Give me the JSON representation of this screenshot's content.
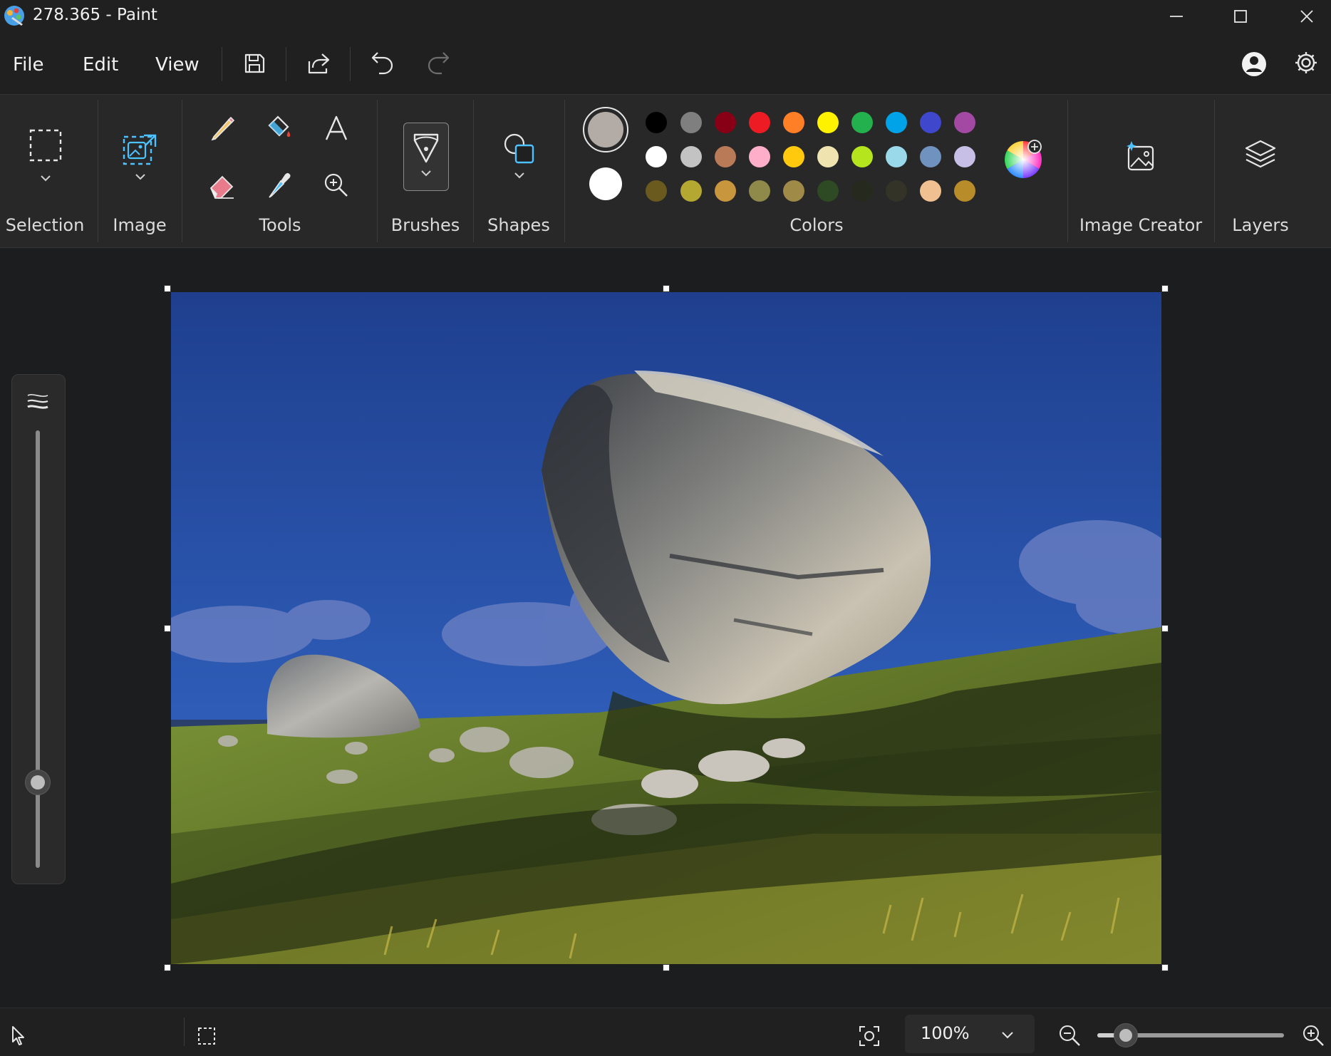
{
  "window": {
    "title": "278.365 - Paint"
  },
  "menu": {
    "file": "File",
    "edit": "Edit",
    "view": "View"
  },
  "ribbon": {
    "groups": {
      "selection": "Selection",
      "image": "Image",
      "tools": "Tools",
      "brushes": "Brushes",
      "shapes": "Shapes",
      "colors": "Colors",
      "image_creator": "Image Creator",
      "layers": "Layers"
    },
    "primary_color": "#b3aca6",
    "secondary_color": "#ffffff",
    "palette": [
      [
        "#000000",
        "#7f7f7f",
        "#880015",
        "#ed1c24",
        "#ff7f27",
        "#fff200",
        "#22b14c",
        "#00a2e8",
        "#3f48cc",
        "#a349a4"
      ],
      [
        "#ffffff",
        "#c3c3c3",
        "#b97a57",
        "#ffaec9",
        "#ffc90e",
        "#efe4b0",
        "#b5e61d",
        "#99d9ea",
        "#7092be",
        "#c8bfe7"
      ],
      [
        "#6b5a1e",
        "#b5a832",
        "#c8963c",
        "#8f8a4a",
        "#a08a48",
        "#2e4a25",
        "#262a1e",
        "#333328",
        "#f0c090",
        "#b88c28"
      ]
    ]
  },
  "status": {
    "zoom": "100%"
  },
  "icons": [
    "paint-app-icon",
    "minimize-icon",
    "maximize-icon",
    "close-icon",
    "save-icon",
    "share-icon",
    "undo-icon",
    "redo-icon",
    "account-icon",
    "settings-icon",
    "pencil-icon",
    "fill-icon",
    "text-icon",
    "eraser-icon",
    "color-picker-icon",
    "magnifier-icon",
    "pointer-icon",
    "selection-size-icon",
    "fit-screen-icon",
    "zoom-out-icon",
    "zoom-in-icon"
  ]
}
